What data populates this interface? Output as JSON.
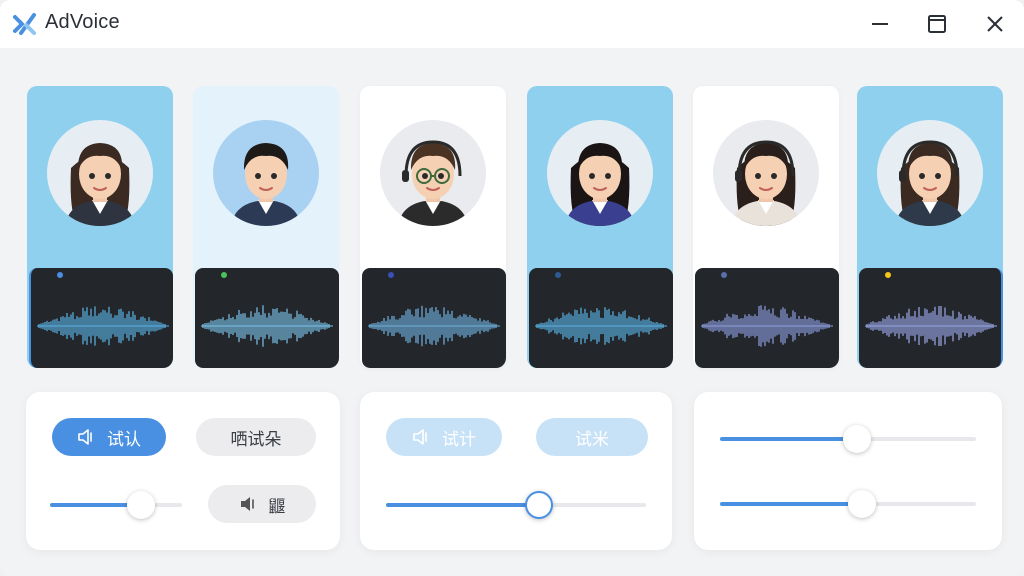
{
  "app": {
    "title": "AdVoice"
  },
  "window_controls": [
    "minimize-icon",
    "maximize-icon",
    "close-icon"
  ],
  "voices": [
    {
      "name": "voice-1",
      "bg": "#8fd0ee",
      "status_color": "#4a90e2",
      "wave_color": "#5ab3e6",
      "selected": true
    },
    {
      "name": "voice-2",
      "bg": "#e4f2fc",
      "status_color": "#49c35a",
      "wave_color": "#7cc3ea",
      "selected": false
    },
    {
      "name": "voice-3",
      "bg": "#ffffff",
      "status_color": "#3b4fb8",
      "wave_color": "#6fb2de",
      "selected": false
    },
    {
      "name": "voice-4",
      "bg": "#8fd0ee",
      "status_color": "#2e5a96",
      "wave_color": "#5ab3e6",
      "selected": false
    },
    {
      "name": "voice-5",
      "bg": "#ffffff",
      "status_color": "#5b6fa8",
      "wave_color": "#8e9ee0",
      "selected": false
    },
    {
      "name": "voice-6",
      "bg": "#8fd0ee",
      "status_color": "#f5c518",
      "wave_color": "#9aa8e8",
      "selected": true
    }
  ],
  "panel_left": {
    "primary_button": {
      "label": "试认",
      "icon": "speaker-icon",
      "color": "#4a90e2"
    },
    "secondary_button": {
      "label": "哂试朵"
    },
    "volume_button": {
      "label": "鼴",
      "icon": "speaker-icon"
    },
    "slider_value": 0.74
  },
  "panel_middle": {
    "primary_button": {
      "label": "试计",
      "icon": "speaker-icon",
      "color": "#c7e2f7"
    },
    "secondary_button": {
      "label": "试米",
      "color": "#c7e2f7"
    },
    "slider_value": 0.6
  },
  "panel_right": {
    "slider_top_value": 0.54,
    "slider_bottom_value": 0.56
  },
  "colors": {
    "accent": "#4a90e2",
    "accent_light": "#c7e2f7",
    "wave_panel": "#23272c"
  }
}
